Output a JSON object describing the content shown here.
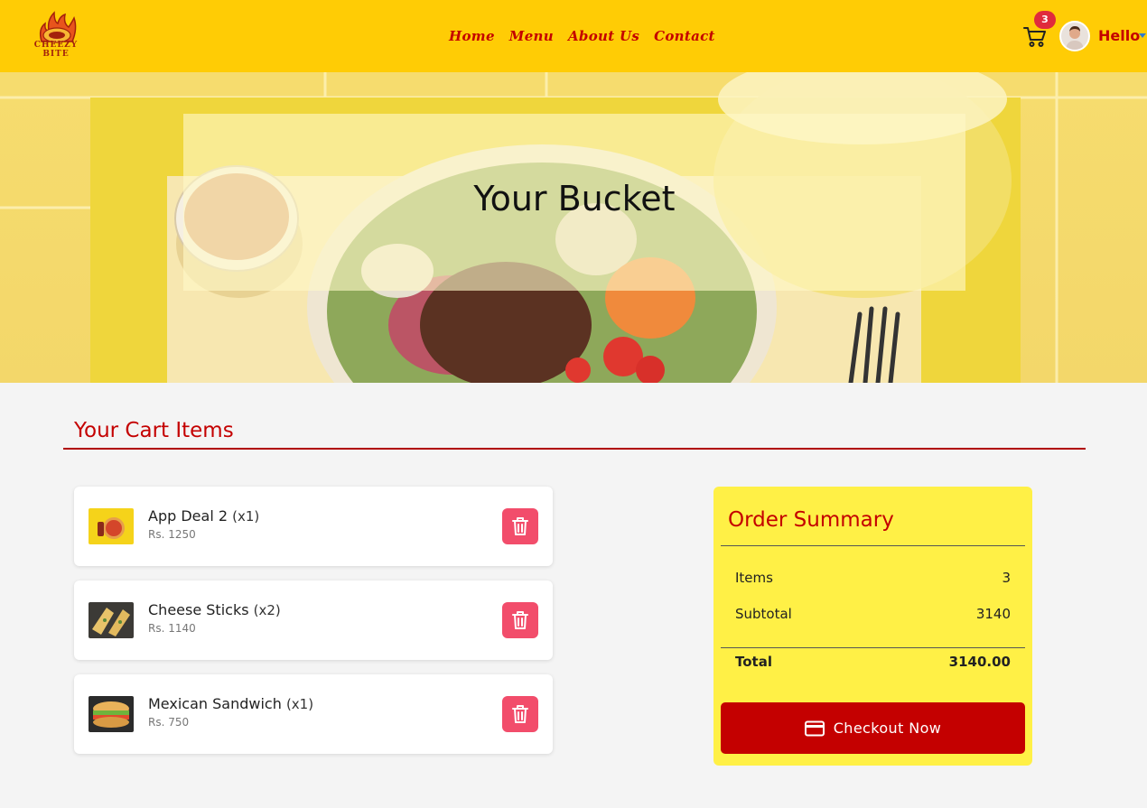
{
  "brand": {
    "name": "CHEEZY BITE"
  },
  "nav": {
    "links": [
      "Home",
      "Menu",
      "About Us",
      "Contact"
    ],
    "cart_count": "3",
    "greeting": "Hello"
  },
  "hero": {
    "title": "Your Bucket"
  },
  "cart": {
    "title": "Your Cart Items",
    "items": [
      {
        "name": "App Deal 2",
        "qty": "(x1)",
        "price": "Rs. 1250"
      },
      {
        "name": "Cheese Sticks",
        "qty": "(x2)",
        "price": "Rs. 1140"
      },
      {
        "name": "Mexican Sandwich",
        "qty": "(x1)",
        "price": "Rs. 750"
      }
    ]
  },
  "summary": {
    "title": "Order Summary",
    "items_label": "Items",
    "items_value": "3",
    "subtotal_label": "Subtotal",
    "subtotal_value": "3140",
    "total_label": "Total",
    "total_value": "3140.00",
    "checkout_label": "Checkout Now"
  },
  "colors": {
    "navbar": "#ffcc05",
    "accent_red": "#c40000",
    "delete_pink": "#f24d6b",
    "summary_bg": "#fff046",
    "badge_red": "#e02b3c"
  },
  "icons": {
    "logo": "flame-logo-icon",
    "cart": "shopping-cart-icon",
    "avatar": "user-avatar",
    "caret": "caret-down-icon",
    "delete": "trash-icon",
    "checkout": "credit-card-icon"
  }
}
